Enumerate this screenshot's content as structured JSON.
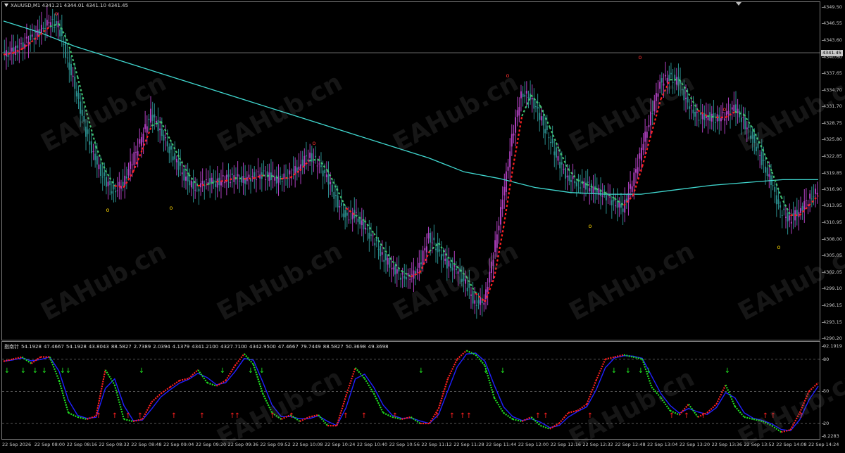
{
  "chart": {
    "symbol_label": "XAUUSD,M1  4341.21 4344.01 4341.10 4341.45",
    "current_price_tag": "4341.45",
    "price_ticks": [
      "4349.50",
      "4346.55",
      "4343.60",
      "4340.60",
      "4337.65",
      "4334.70",
      "4331.70",
      "4328.75",
      "4325.80",
      "4322.85",
      "4319.85",
      "4316.90",
      "4313.95",
      "4310.95",
      "4308.00",
      "4305.05",
      "4302.05",
      "4299.10",
      "4296.15",
      "4293.15",
      "4290.20"
    ],
    "indicator_label": [
      "指南针",
      "54.1928",
      "47.4667",
      "54.1928",
      "43.8043",
      "88.5827",
      "2.7389",
      "2.0394",
      "4.1379",
      "4341.2100",
      "4327.7100",
      "4342.9500",
      "47.4667",
      "79.7449",
      "88.5827",
      "50.3698",
      "49.3698"
    ],
    "indicator_ticks": [
      "92.1919",
      "80",
      "50",
      "20",
      "8.2283"
    ],
    "time_ticks": [
      "22 Sep 2026",
      "22 Sep 08:00",
      "22 Sep 08:16",
      "22 Sep 08:32",
      "22 Sep 08:48",
      "22 Sep 09:04",
      "22 Sep 09:20",
      "22 Sep 09:36",
      "22 Sep 09:52",
      "22 Sep 10:08",
      "22 Sep 10:24",
      "22 Sep 10:40",
      "22 Sep 10:56",
      "22 Sep 11:12",
      "22 Sep 11:28",
      "22 Sep 11:44",
      "22 Sep 12:00",
      "22 Sep 12:16",
      "22 Sep 12:32",
      "22 Sep 12:48",
      "22 Sep 13:04",
      "22 Sep 13:20",
      "22 Sep 13:36",
      "22 Sep 13:52",
      "22 Sep 14:08",
      "22 Sep 14:24"
    ],
    "watermark": "EAHub.cn",
    "colors": {
      "background": "#000000",
      "bull": "#b040c0",
      "bear": "#2a8c8c",
      "ma": "#40d8d0",
      "trend_up": "#ff2020",
      "trend_down": "#40c070",
      "arrow_up": "#ff2020",
      "arrow_down": "#20e020",
      "ind_blue": "#2020ff",
      "signal_marker": "#ffd700"
    },
    "price_series": [
      4341.0,
      4341.5,
      4342.5,
      4344.0,
      4345.2,
      4346.8,
      4346.2,
      4340.0,
      4334.0,
      4327.0,
      4322.0,
      4318.5,
      4316.5,
      4318.0,
      4322.0,
      4326.0,
      4330.5,
      4327.5,
      4324.0,
      4321.0,
      4318.0,
      4317.0,
      4318.5,
      4318.0,
      4318.8,
      4319.0,
      4318.5,
      4319.2,
      4319.5,
      4319.0,
      4318.5,
      4319.5,
      4321.0,
      4323.0,
      4321.5,
      4319.0,
      4315.0,
      4312.0,
      4312.5,
      4310.0,
      4308.0,
      4305.0,
      4303.0,
      4301.5,
      4301.0,
      4303.0,
      4308.5,
      4306.0,
      4303.5,
      4302.5,
      4300.0,
      4296.5,
      4297.0,
      4305.0,
      4315.0,
      4326.0,
      4334.0,
      4333.5,
      4330.0,
      4326.0,
      4322.0,
      4319.0,
      4318.0,
      4317.5,
      4316.5,
      4316.0,
      4314.5,
      4313.5,
      4318.0,
      4324.0,
      4330.0,
      4336.0,
      4337.0,
      4336.0,
      4332.0,
      4330.0,
      4330.0,
      4329.5,
      4330.0,
      4331.5,
      4329.0,
      4326.0,
      4322.0,
      4318.0,
      4313.0,
      4311.5,
      4313.0,
      4315.0,
      4316.5
    ],
    "ma_series": [
      4347.0,
      4345.0,
      4342.5,
      4340.5,
      4338.5,
      4336.5,
      4334.5,
      4332.5,
      4330.5,
      4328.5,
      4326.5,
      4324.5,
      4322.5,
      4320.0,
      4318.8,
      4317.2,
      4316.3,
      4316.0,
      4316.0,
      4316.8,
      4317.6,
      4318.1,
      4318.6,
      4318.6
    ],
    "indicator_series": [
      78,
      80,
      82,
      76,
      82,
      82,
      60,
      30,
      26,
      24,
      27,
      70,
      56,
      24,
      22,
      24,
      40,
      48,
      54,
      60,
      62,
      70,
      58,
      55,
      60,
      74,
      85,
      75,
      48,
      30,
      24,
      28,
      22,
      26,
      28,
      18,
      18,
      46,
      72,
      62,
      48,
      30,
      26,
      24,
      26,
      20,
      20,
      34,
      62,
      80,
      88,
      84,
      74,
      44,
      30,
      24,
      22,
      26,
      18,
      15,
      20,
      30,
      32,
      38,
      60,
      80,
      82,
      84,
      82,
      80,
      54,
      44,
      32,
      28,
      38,
      26,
      30,
      38,
      56,
      36,
      26,
      24,
      22,
      18,
      12,
      14,
      30,
      50,
      58
    ]
  }
}
